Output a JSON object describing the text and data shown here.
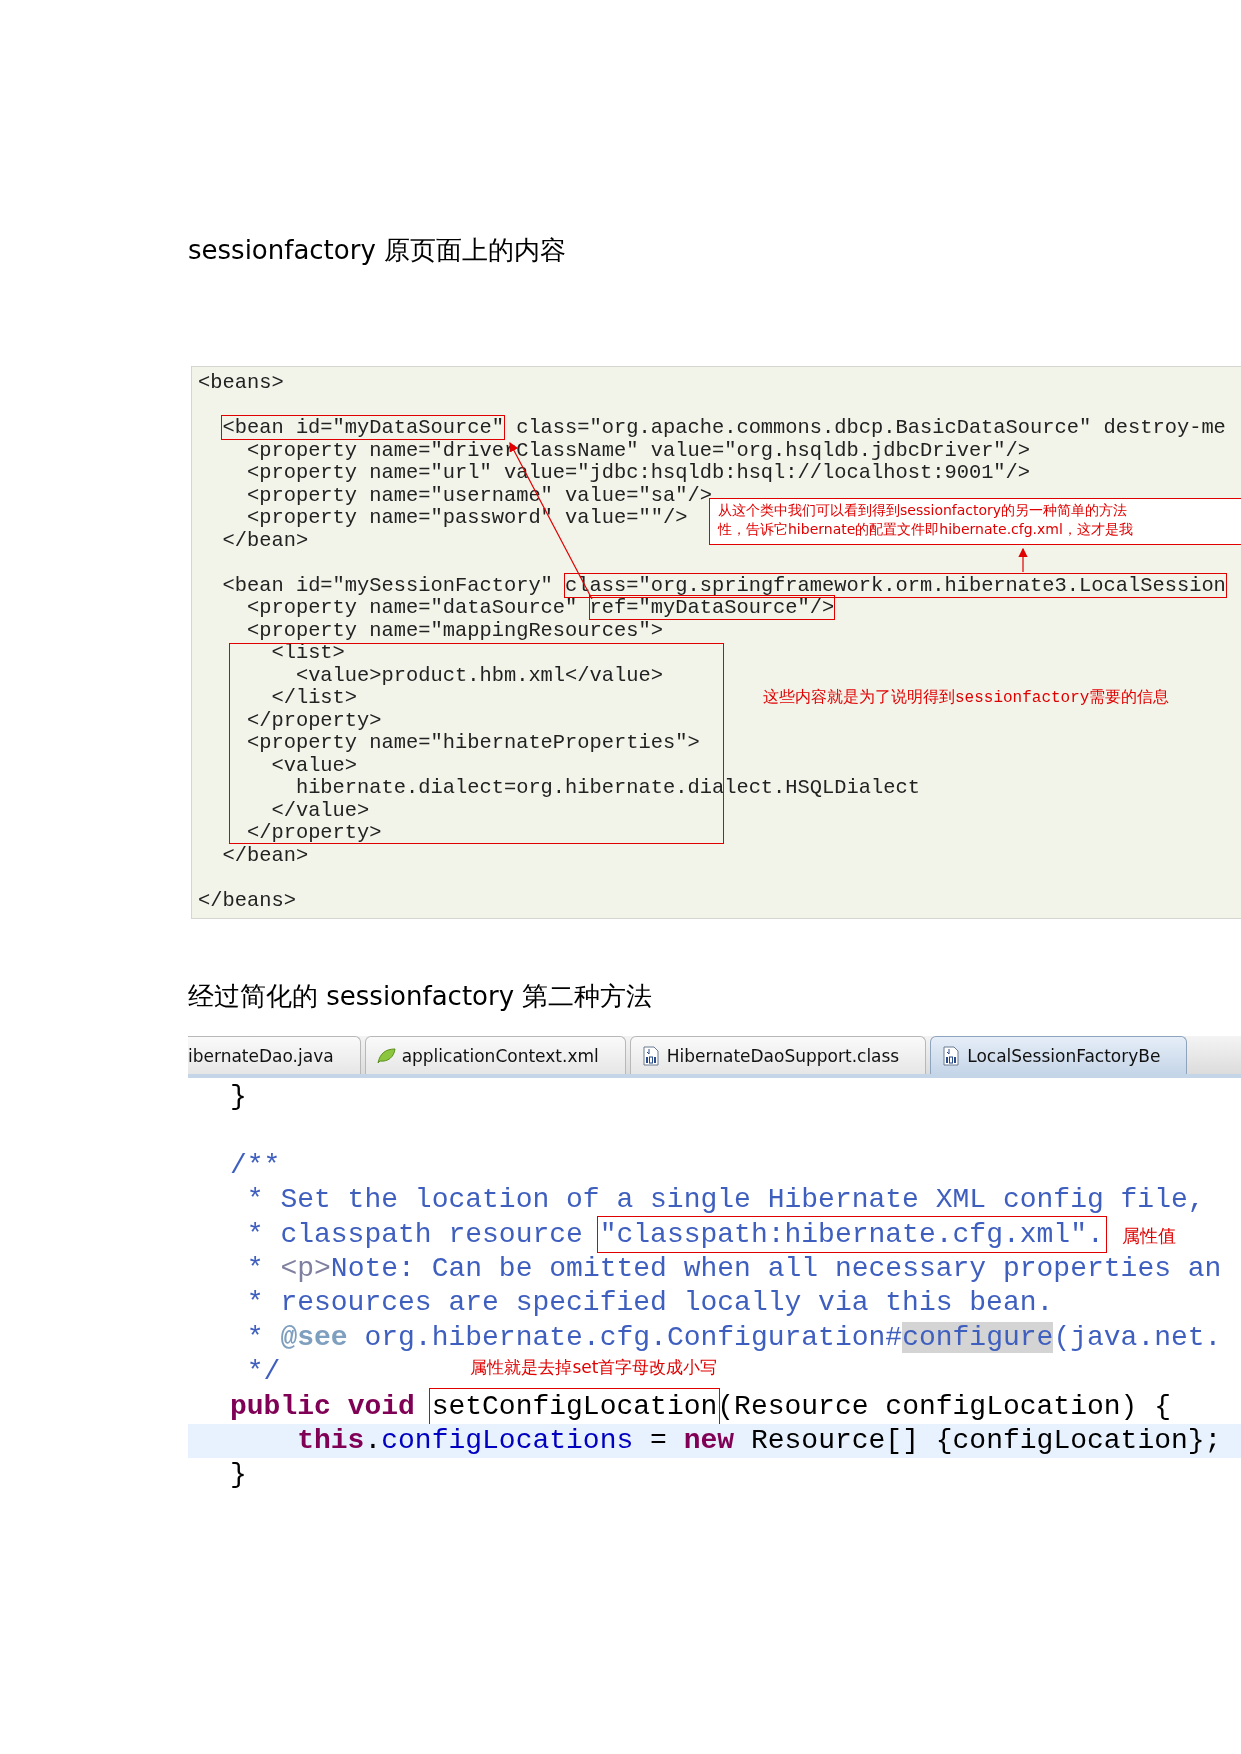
{
  "section_1": {
    "heading": "sessionfactory 原页面上的内容",
    "code_lines": [
      {
        "kind": "code",
        "segments": [
          {
            "kind": "plain",
            "text": "<beans>"
          }
        ]
      },
      {
        "kind": "blank"
      },
      {
        "kind": "code",
        "segments": [
          {
            "kind": "boxed",
            "text": "<bean id=\"myDataSource\""
          },
          {
            "kind": "plain",
            "text": " class=\"org.apache.commons.dbcp.BasicDataSource\" destroy-me"
          }
        ]
      },
      {
        "kind": "code",
        "segments": [
          {
            "kind": "plain",
            "text": "    <property name=\"driverClassName\" value=\"org.hsqldb.jdbcDriver\"/>"
          }
        ]
      },
      {
        "kind": "code",
        "segments": [
          {
            "kind": "plain",
            "text": "    <property name=\"url\" value=\"jdbc:hsqldb:hsql://localhost:9001\"/>"
          }
        ]
      },
      {
        "kind": "code",
        "segments": [
          {
            "kind": "plain",
            "text": "    <property name=\"username\" value=\"sa\"/>"
          }
        ]
      },
      {
        "kind": "code",
        "segments": [
          {
            "kind": "plain",
            "text": "    <property name=\"password\" value=\"\"/>"
          }
        ]
      },
      {
        "kind": "code",
        "segments": [
          {
            "kind": "plain",
            "text": "  </bean>"
          }
        ]
      },
      {
        "kind": "blank"
      },
      {
        "kind": "code",
        "segments": [
          {
            "kind": "plain",
            "text": "  <bean id=\"mySessionFactory\" "
          },
          {
            "kind": "boxed",
            "text": "class=\"org.springframework.orm.hibernate3.LocalSession"
          }
        ]
      },
      {
        "kind": "code",
        "segments": [
          {
            "kind": "plain",
            "text": "    <property name=\"dataSource\" "
          },
          {
            "kind": "boxed",
            "text": "ref=\"myDataSource\"/>"
          }
        ]
      },
      {
        "kind": "code",
        "segments": [
          {
            "kind": "plain",
            "text": "    <property name=\"mappingResources\">"
          }
        ]
      },
      {
        "kind": "code",
        "segments": [
          {
            "kind": "plain",
            "text": "      <list>"
          }
        ]
      },
      {
        "kind": "code",
        "segments": [
          {
            "kind": "plain",
            "text": "        <value>product.hbm.xml</value>"
          }
        ]
      },
      {
        "kind": "code",
        "segments": [
          {
            "kind": "plain",
            "text": "      </list>"
          }
        ]
      },
      {
        "kind": "code",
        "segments": [
          {
            "kind": "plain",
            "text": "    </property>"
          }
        ]
      },
      {
        "kind": "code",
        "segments": [
          {
            "kind": "plain",
            "text": "    <property name=\"hibernateProperties\">"
          }
        ]
      },
      {
        "kind": "code",
        "segments": [
          {
            "kind": "plain",
            "text": "      <value>"
          }
        ]
      },
      {
        "kind": "code",
        "segments": [
          {
            "kind": "plain",
            "text": "        hibernate.dialect=org.hibernate.dialect.HSQLDialect"
          }
        ]
      },
      {
        "kind": "code",
        "segments": [
          {
            "kind": "plain",
            "text": "      </value>"
          }
        ]
      },
      {
        "kind": "code",
        "segments": [
          {
            "kind": "plain",
            "text": "    </property>"
          }
        ]
      },
      {
        "kind": "code",
        "segments": [
          {
            "kind": "plain",
            "text": "  </bean>"
          }
        ]
      },
      {
        "kind": "blank"
      },
      {
        "kind": "code",
        "segments": [
          {
            "kind": "plain",
            "text": "</beans>"
          }
        ]
      }
    ],
    "callout": [
      "从这个类中我们可以看到得到sessionfactory的另一种简单的方法",
      "性，告诉它hibernate的配置文件即hibernate.cfg.xml，这才是我"
    ],
    "note": "这些内容就是为了说明得到sessionfactory需要的信息"
  },
  "section_2": {
    "heading": "经过简化的 sessionfactory 第二种方法",
    "tabs": [
      {
        "label": "ibernateDao.java",
        "selected": false
      },
      {
        "label": "applicationContext.xml",
        "selected": false
      },
      {
        "label": "HibernateDaoSupport.class",
        "selected": false
      },
      {
        "label": "LocalSessionFactoryBe",
        "selected": true
      }
    ],
    "code_lines": [
      {
        "kind": "code",
        "segments": [
          {
            "kind": "plain",
            "text": "}"
          }
        ]
      },
      {
        "kind": "blank"
      },
      {
        "kind": "code",
        "segments": [
          {
            "kind": "comment",
            "text": "/**"
          }
        ]
      },
      {
        "kind": "code",
        "segments": [
          {
            "kind": "comment",
            "text": " * Set the location of a single Hibernate XML config file,"
          }
        ]
      },
      {
        "kind": "code",
        "segments": [
          {
            "kind": "comment",
            "text": " * classpath resource "
          },
          {
            "kind": "boxed-comment",
            "text": "\"classpath:hibernate.cfg.xml\"."
          },
          {
            "kind": "note",
            "text": "属性值"
          }
        ]
      },
      {
        "kind": "code",
        "segments": [
          {
            "kind": "comment",
            "text": " * "
          },
          {
            "kind": "html",
            "text": "<p>"
          },
          {
            "kind": "comment",
            "text": "Note: Can be omitted when all necessary properties an"
          }
        ]
      },
      {
        "kind": "code",
        "segments": [
          {
            "kind": "comment",
            "text": " * resources are specified locally via this bean."
          }
        ]
      },
      {
        "kind": "code",
        "segments": [
          {
            "kind": "comment",
            "text": " * "
          },
          {
            "kind": "doctag",
            "text": "@see"
          },
          {
            "kind": "comment",
            "text": " org.hibernate.cfg.Configuration#"
          },
          {
            "kind": "match",
            "text": "configure"
          },
          {
            "kind": "comment",
            "text": "(java.net."
          }
        ]
      },
      {
        "kind": "code",
        "segments": [
          {
            "kind": "comment",
            "text": " */"
          },
          {
            "kind": "note-raised",
            "text": "属性就是去掉set首字母改成小写"
          }
        ]
      },
      {
        "kind": "code",
        "segments": [
          {
            "kind": "keyword",
            "text": "public "
          },
          {
            "kind": "keyword",
            "text": "void "
          },
          {
            "kind": "boxed",
            "text": "setConfigLocation"
          },
          {
            "kind": "plain",
            "text": "(Resource configLocation) {"
          }
        ]
      },
      {
        "kind": "current",
        "segments": [
          {
            "kind": "keyword",
            "text": "    this"
          },
          {
            "kind": "plain",
            "text": "."
          },
          {
            "kind": "field",
            "text": "configLocations"
          },
          {
            "kind": "plain",
            "text": " = "
          },
          {
            "kind": "keyword",
            "text": "new"
          },
          {
            "kind": "plain",
            "text": " Resource[] {configLocation};"
          }
        ]
      },
      {
        "kind": "code",
        "segments": [
          {
            "kind": "plain",
            "text": "}"
          }
        ]
      }
    ]
  }
}
